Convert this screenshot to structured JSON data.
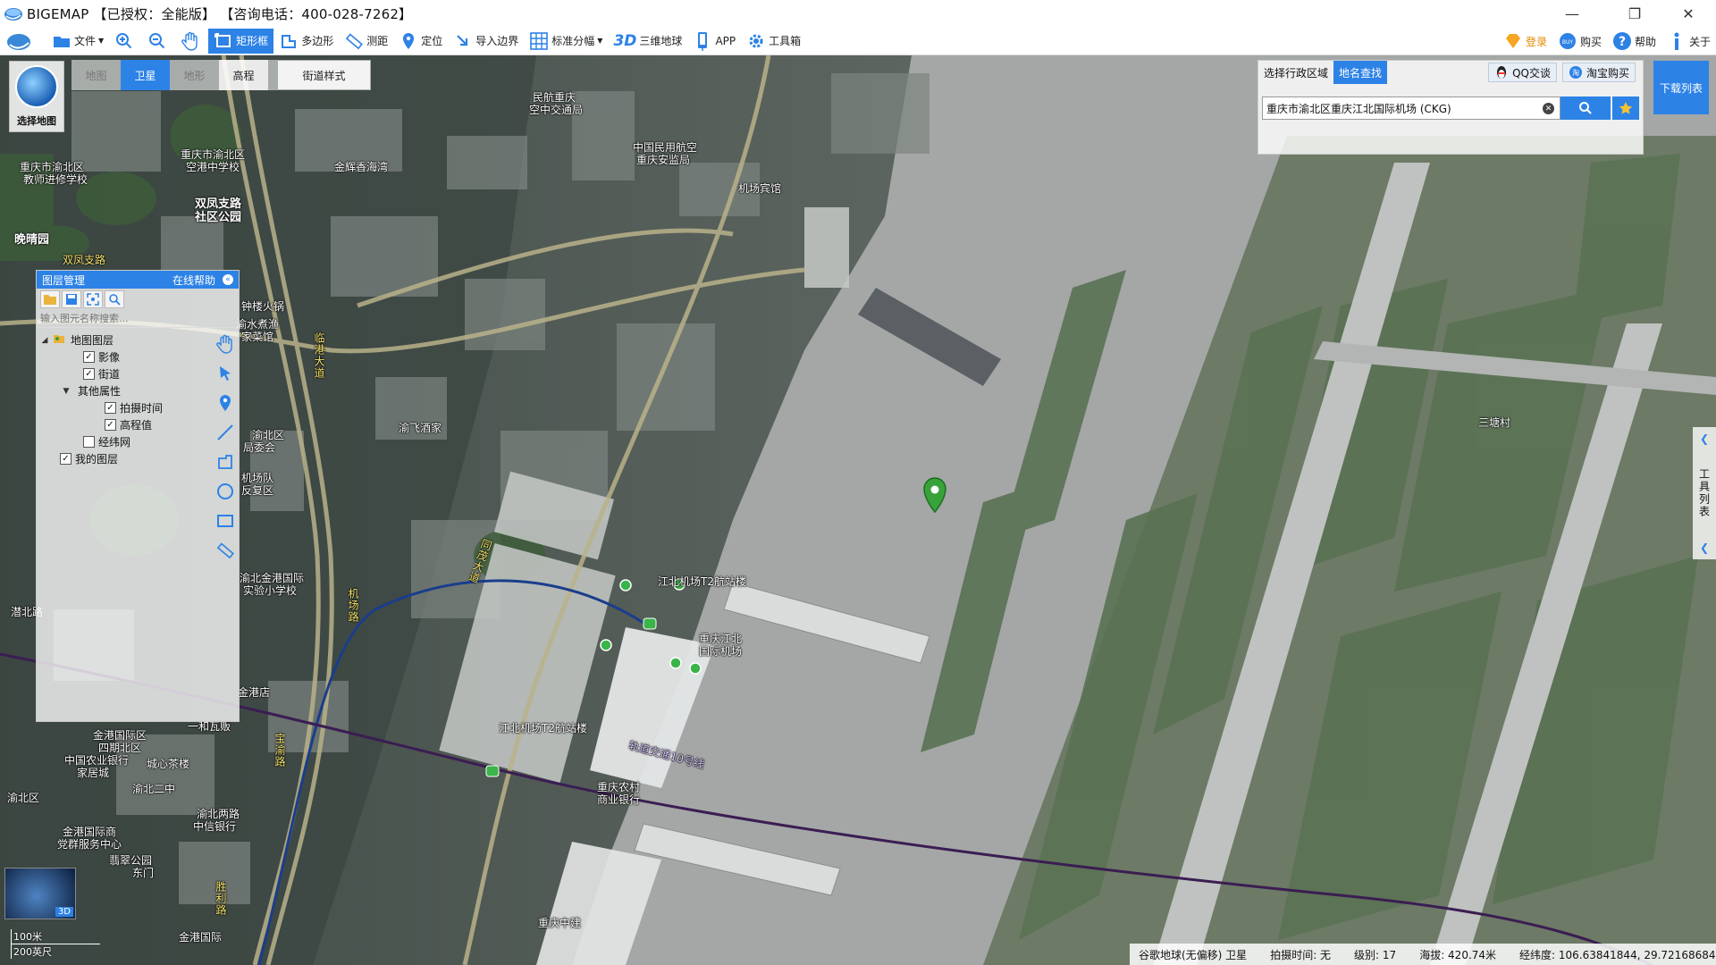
{
  "app": {
    "title": "BIGEMAP 【已授权：全能版】 【咨询电话：400-028-7262】"
  },
  "toolbar": {
    "items": [
      {
        "label": "文件",
        "dropdown": true
      },
      {
        "label": ""
      },
      {
        "label": ""
      },
      {
        "label": ""
      },
      {
        "label": "矩形框",
        "active": true
      },
      {
        "label": "多边形"
      },
      {
        "label": "测距"
      },
      {
        "label": "定位"
      },
      {
        "label": "导入边界"
      },
      {
        "label": "标准分幅",
        "dropdown": true
      },
      {
        "label": "三维地球"
      },
      {
        "label": "APP"
      },
      {
        "label": "工具箱"
      }
    ],
    "right": [
      "登录",
      "购买",
      "帮助",
      "关于"
    ]
  },
  "map_tabs": [
    "地图",
    "卫星",
    "地形",
    "高程",
    "街道样式"
  ],
  "select_map_label": "选择地图",
  "layer_panel": {
    "title": "图层管理",
    "help": "在线帮助",
    "search_placeholder": "输入图元名称搜索...",
    "tree": [
      {
        "label": "地图图层",
        "level": 0,
        "expanded": true,
        "folder": true
      },
      {
        "label": "影像",
        "level": 1,
        "checked": true
      },
      {
        "label": "街道",
        "level": 1,
        "checked": true
      },
      {
        "label": "其他属性",
        "level": 1,
        "expanded": true
      },
      {
        "label": "拍摄时间",
        "level": 2,
        "checked": true
      },
      {
        "label": "高程值",
        "level": 2,
        "checked": true
      },
      {
        "label": "经纬网",
        "level": 1,
        "checked": false
      },
      {
        "label": "我的图层",
        "level": 0,
        "checked": true
      }
    ]
  },
  "search_panel": {
    "tabs": [
      "选择行政区域",
      "地名查找"
    ],
    "qq_label": "QQ交谈",
    "taobao_label": "淘宝购买",
    "query": "重庆市渝北区重庆江北国际机场 (CKG)"
  },
  "download_list": "下载列表",
  "tool_list": "工具列表",
  "map_labels": [
    {
      "text": "重庆市渝北区",
      "color": "white"
    },
    {
      "text": "教师进修学校",
      "color": "white"
    },
    {
      "text": "重庆市渝北区",
      "color": "white"
    },
    {
      "text": "空港中学校",
      "color": "white"
    },
    {
      "text": "金辉香海湾",
      "color": "white"
    },
    {
      "text": "民航重庆",
      "color": "white"
    },
    {
      "text": "空中交通局",
      "color": "white"
    },
    {
      "text": "中国民用航空",
      "color": "white"
    },
    {
      "text": "重庆安监局",
      "color": "white"
    },
    {
      "text": "机场宾馆",
      "color": "white"
    },
    {
      "text": "双凤支路",
      "color": "white"
    },
    {
      "text": "社区公园",
      "color": "white"
    },
    {
      "text": "晚晴园",
      "color": "white"
    },
    {
      "text": "双凤支路",
      "color": "yellow"
    },
    {
      "text": "临港大道",
      "color": "yellow"
    },
    {
      "text": "钟楼火锅",
      "color": "white"
    },
    {
      "text": "渝水煮渔",
      "color": "white"
    },
    {
      "text": "家菜馆",
      "color": "white"
    },
    {
      "text": "渝飞酒家",
      "color": "white"
    },
    {
      "text": "渝北区",
      "color": "white"
    },
    {
      "text": "局委会",
      "color": "white"
    },
    {
      "text": "机场队",
      "color": "white"
    },
    {
      "text": "反复区",
      "color": "white"
    },
    {
      "text": "同茂大道",
      "color": "yellow"
    },
    {
      "text": "江北机场T2航站楼",
      "color": "white"
    },
    {
      "text": "重庆江北",
      "color": "white"
    },
    {
      "text": "国际机场",
      "color": "white"
    },
    {
      "text": "机场路",
      "color": "yellow"
    },
    {
      "text": "渝北金港国际",
      "color": "white"
    },
    {
      "text": "实验小学校",
      "color": "white"
    },
    {
      "text": "金港店",
      "color": "white"
    },
    {
      "text": "江北机场T2航站楼",
      "color": "white"
    },
    {
      "text": "轨道交通10号线",
      "color": "white"
    },
    {
      "text": "重庆农村",
      "color": "white"
    },
    {
      "text": "商业银行",
      "color": "white"
    },
    {
      "text": "金港国际区",
      "color": "white"
    },
    {
      "text": "四期北区",
      "color": "white"
    },
    {
      "text": "中国农业银行",
      "color": "white"
    },
    {
      "text": "家居城",
      "color": "white"
    },
    {
      "text": "城心茶楼",
      "color": "white"
    },
    {
      "text": "渝北二中",
      "color": "white"
    },
    {
      "text": "渝北两路",
      "color": "white"
    },
    {
      "text": "中信银行",
      "color": "white"
    },
    {
      "text": "金港国际商",
      "color": "white"
    },
    {
      "text": "党群服务中心",
      "color": "white"
    },
    {
      "text": "翡翠公园",
      "color": "white"
    },
    {
      "text": "东门",
      "color": "white"
    },
    {
      "text": "金港国际",
      "color": "white"
    },
    {
      "text": "重庆中建",
      "color": "white"
    },
    {
      "text": "胜利路",
      "color": "yellow"
    },
    {
      "text": "宝渝路",
      "color": "yellow"
    },
    {
      "text": "三塘村",
      "color": "white"
    },
    {
      "text": "一和瓦贩",
      "color": "white"
    },
    {
      "text": "潜北路",
      "color": "white"
    },
    {
      "text": "渝北区",
      "color": "white"
    }
  ],
  "scale": {
    "km": "100米",
    "ft": "200英尺"
  },
  "minimap_3d": "3D",
  "status": {
    "source": "谷歌地球(无偏移) 卫星",
    "shot_time": "拍摄时间: 无",
    "level": "级别: 17",
    "elevation": "海拔: 420.74米",
    "coords": "经纬度: 106.63841844, 29.72168684"
  },
  "colors": {
    "accent": "#2d82e6"
  }
}
